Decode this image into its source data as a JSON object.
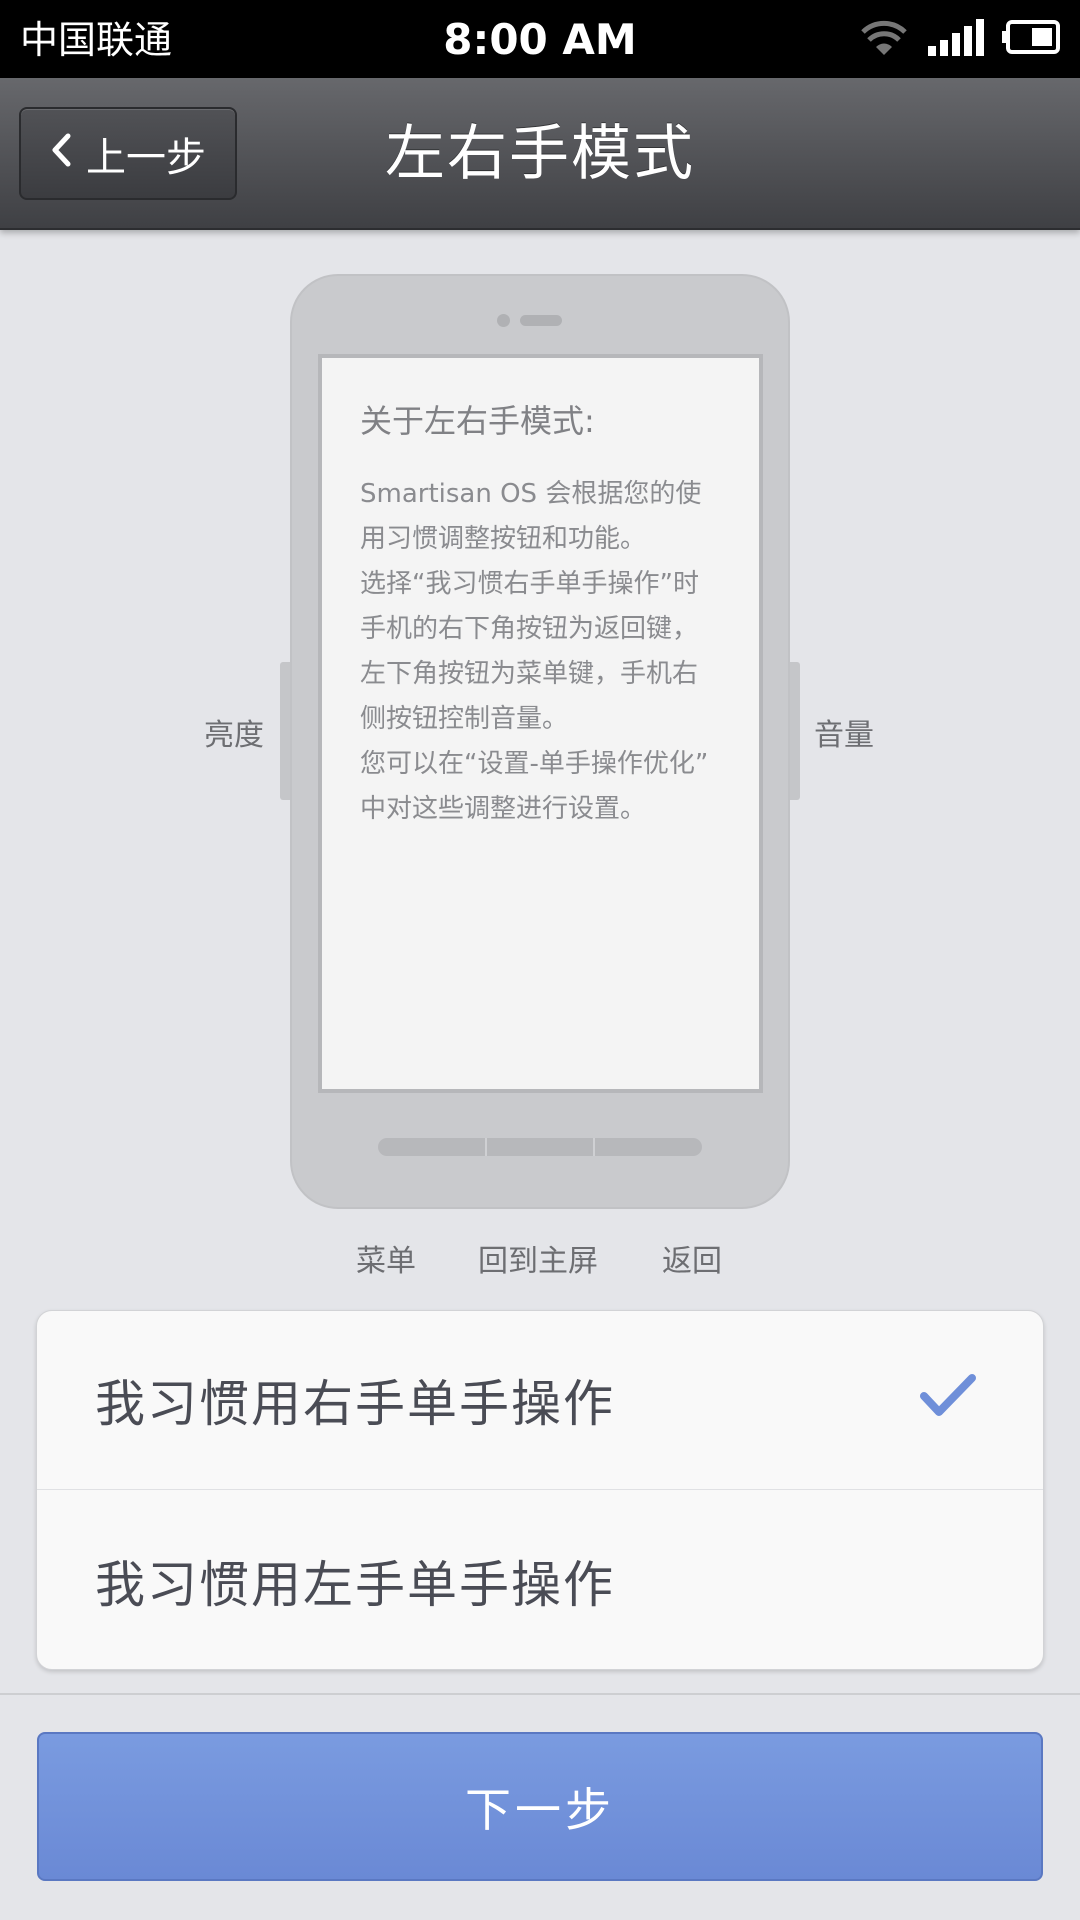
{
  "status_bar": {
    "carrier": "中国联通",
    "time": "8:00 AM",
    "icons": [
      "wifi-icon",
      "signal-icon",
      "battery-icon"
    ]
  },
  "header": {
    "back_label": "上一步",
    "title": "左右手模式"
  },
  "illustration": {
    "info_title": "关于左右手模式:",
    "info_body": "Smartisan OS 会根据您的使\n用习惯调整按钮和功能。\n选择“我习惯右手单手操作”时\n手机的右下角按钮为返回键，\n左下角按钮为菜单键，手机右\n侧按钮控制音量。\n您可以在“设置-单手操作优化”\n中对这些调整进行设置。",
    "left_label": "亮度",
    "right_label": "音量",
    "bottom_labels": [
      "菜单",
      "回到主屏",
      "返回"
    ]
  },
  "options": {
    "right_hand": "我习惯用右手单手操作",
    "left_hand": "我习惯用左手单手操作",
    "selected": "right_hand"
  },
  "footer": {
    "next_label": "下一步"
  },
  "colors": {
    "accent": "#6f8fd9",
    "check": "#6f8fd9"
  }
}
